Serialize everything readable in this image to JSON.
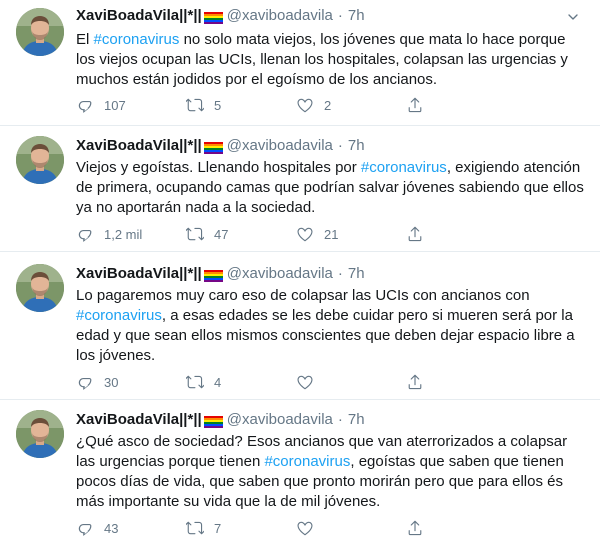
{
  "tweets": [
    {
      "name": "XaviBoadaVila||*||",
      "handle": "@xaviboadavila",
      "separator": "·",
      "time": "7h",
      "text_parts": [
        {
          "t": "El ",
          "tag": false
        },
        {
          "t": "#coronavirus",
          "tag": true
        },
        {
          "t": " no solo mata viejos, los jóvenes que mata lo hace porque los viejos ocupan las UCIs, llenan los hospitales, colapsan las urgencias y muchos están jodidos por el egoísmo de los ancianos.",
          "tag": false
        }
      ],
      "replies": "107",
      "retweets": "5",
      "likes": "2"
    },
    {
      "name": "XaviBoadaVila||*||",
      "handle": "@xaviboadavila",
      "separator": "·",
      "time": "7h",
      "text_parts": [
        {
          "t": "Viejos y egoístas. Llenando hospitales por ",
          "tag": false
        },
        {
          "t": "#coronavirus",
          "tag": true
        },
        {
          "t": ", exigiendo atención de primera, ocupando camas que podrían salvar jóvenes sabiendo que ellos ya no aportarán nada a la sociedad.",
          "tag": false
        }
      ],
      "replies": "1,2 mil",
      "retweets": "47",
      "likes": "21"
    },
    {
      "name": "XaviBoadaVila||*||",
      "handle": "@xaviboadavila",
      "separator": "·",
      "time": "7h",
      "text_parts": [
        {
          "t": "Lo pagaremos muy caro eso de colapsar las UCIs con ancianos con ",
          "tag": false
        },
        {
          "t": "#coronavirus",
          "tag": true
        },
        {
          "t": ", a esas edades se les debe cuidar pero si mueren será por la edad y que sean ellos mismos conscientes que deben dejar espacio libre a los jóvenes.",
          "tag": false
        }
      ],
      "replies": "30",
      "retweets": "4",
      "likes": ""
    },
    {
      "name": "XaviBoadaVila||*||",
      "handle": "@xaviboadavila",
      "separator": "·",
      "time": "7h",
      "text_parts": [
        {
          "t": "¿Qué asco de sociedad? Esos ancianos que van aterrorizados a colapsar las urgencias porque tienen ",
          "tag": false
        },
        {
          "t": "#coronavirus",
          "tag": true
        },
        {
          "t": ", egoístas que saben que tienen pocos días de vida, que saben que pronto morirán pero que para ellos és más importante su vida que la de mil jóvenes.",
          "tag": false
        }
      ],
      "replies": "43",
      "retweets": "7",
      "likes": ""
    }
  ],
  "colors": {
    "text": "#14171a",
    "secondary": "#657786",
    "link": "#1da1f2",
    "divider": "#e6ecf0"
  },
  "icons": {
    "reply": "reply-icon",
    "retweet": "retweet-icon",
    "like": "like-icon",
    "share": "share-icon",
    "caret": "chevron-down-icon",
    "flag": "rainbow-flag-icon"
  }
}
